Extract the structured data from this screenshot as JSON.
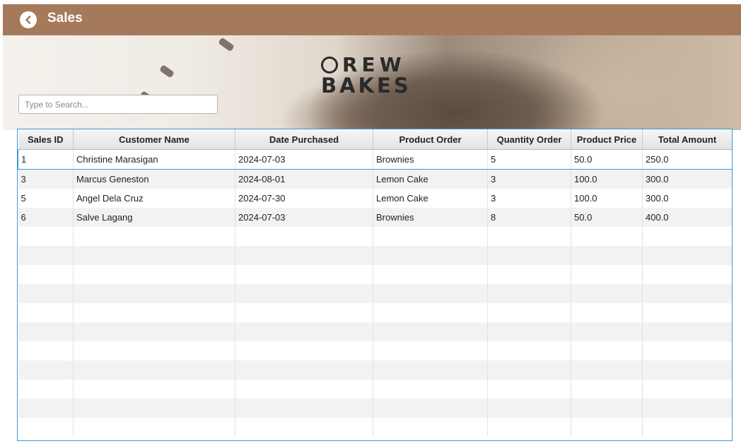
{
  "header": {
    "title": "Sales",
    "back_icon": "chevron-left-icon",
    "background": "#a57a5b"
  },
  "banner": {
    "logo_line1": "REW",
    "logo_line2": "BAKES"
  },
  "search": {
    "placeholder": "Type to Search...",
    "value": ""
  },
  "table": {
    "columns": [
      "Sales ID",
      "Customer Name",
      "Date Purchased",
      "Product Order",
      "Quantity Order",
      "Product Price",
      "Total Amount"
    ],
    "rows": [
      [
        "1",
        "Christine Marasigan",
        "2024-07-03",
        "Brownies",
        "5",
        "50.0",
        "250.0"
      ],
      [
        "3",
        "Marcus Geneston",
        "2024-08-01",
        "Lemon Cake",
        "3",
        "100.0",
        "300.0"
      ],
      [
        "5",
        "Angel Dela Cruz",
        "2024-07-30",
        "Lemon Cake",
        "3",
        "100.0",
        "300.0"
      ],
      [
        "6",
        "Salve Lagang",
        "2024-07-03",
        "Brownies",
        "8",
        "50.0",
        "400.0"
      ]
    ],
    "selected_row_index": 0,
    "accent": "#3a9ad9"
  }
}
